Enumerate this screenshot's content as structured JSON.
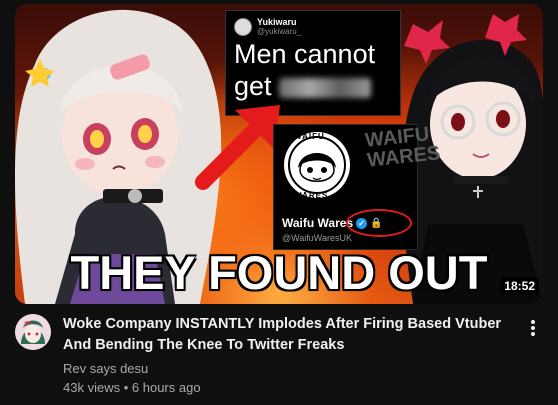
{
  "video": {
    "thumbnail": {
      "headline": "THEY FOUND OUT",
      "duration": "18:52",
      "tweet": {
        "username": "Yukiwaru",
        "handle": "@yukiwaru_",
        "text_line1": "Men cannot",
        "text_line2": "get"
      },
      "waifu_card": {
        "logo_text_top": "WAIFU",
        "logo_text_bottom": "WARES",
        "name": "Waifu Wares",
        "handle": "@WaifuWaresUK",
        "background_text": "WAIFU\nWARES"
      },
      "choker_tag": "brat"
    },
    "title": "Woke Company INSTANTLY Implodes After Firing Based Vtuber And Bending The Knee To Twitter Freaks",
    "channel": "Rev says desu",
    "views": "43k views",
    "separator": "•",
    "age": "6 hours ago"
  },
  "colors": {
    "background": "#0f0f0f",
    "text_primary": "#f1f1f1",
    "text_secondary": "#aaaaaa",
    "verified": "#1d9bf0",
    "highlight": "#e21d1d"
  },
  "icons": [
    "more-vert-icon",
    "verified-icon",
    "lock-icon",
    "red-arrow-icon"
  ]
}
